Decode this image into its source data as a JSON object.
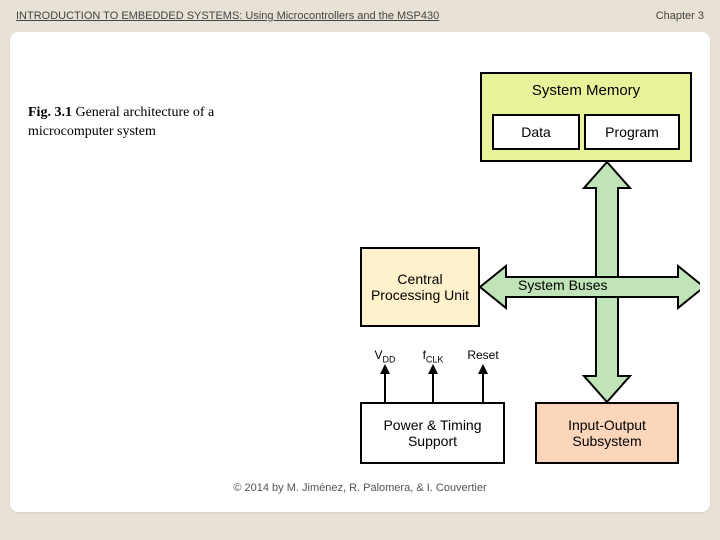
{
  "header": {
    "title": "INTRODUCTION TO EMBEDDED SYSTEMS: Using Microcontrollers and the MSP430",
    "chapter": "Chapter 3"
  },
  "caption": {
    "fignum": "Fig. 3.1",
    "text": "General architecture of a microcomputer system"
  },
  "diagram": {
    "system_memory": {
      "title": "System Memory",
      "data": "Data",
      "program": "Program"
    },
    "cpu": "Central Processing Unit",
    "buses": "System Buses",
    "power": "Power & Timing Support",
    "io": "Input-Output Subsystem",
    "signals": {
      "vdd": "V",
      "vdd_sub": "DD",
      "fclk": "f",
      "fclk_sub": "CLK",
      "reset": "Reset"
    }
  },
  "footer": "© 2014 by M. Jiménez, R. Palomera, & I. Couvertier"
}
